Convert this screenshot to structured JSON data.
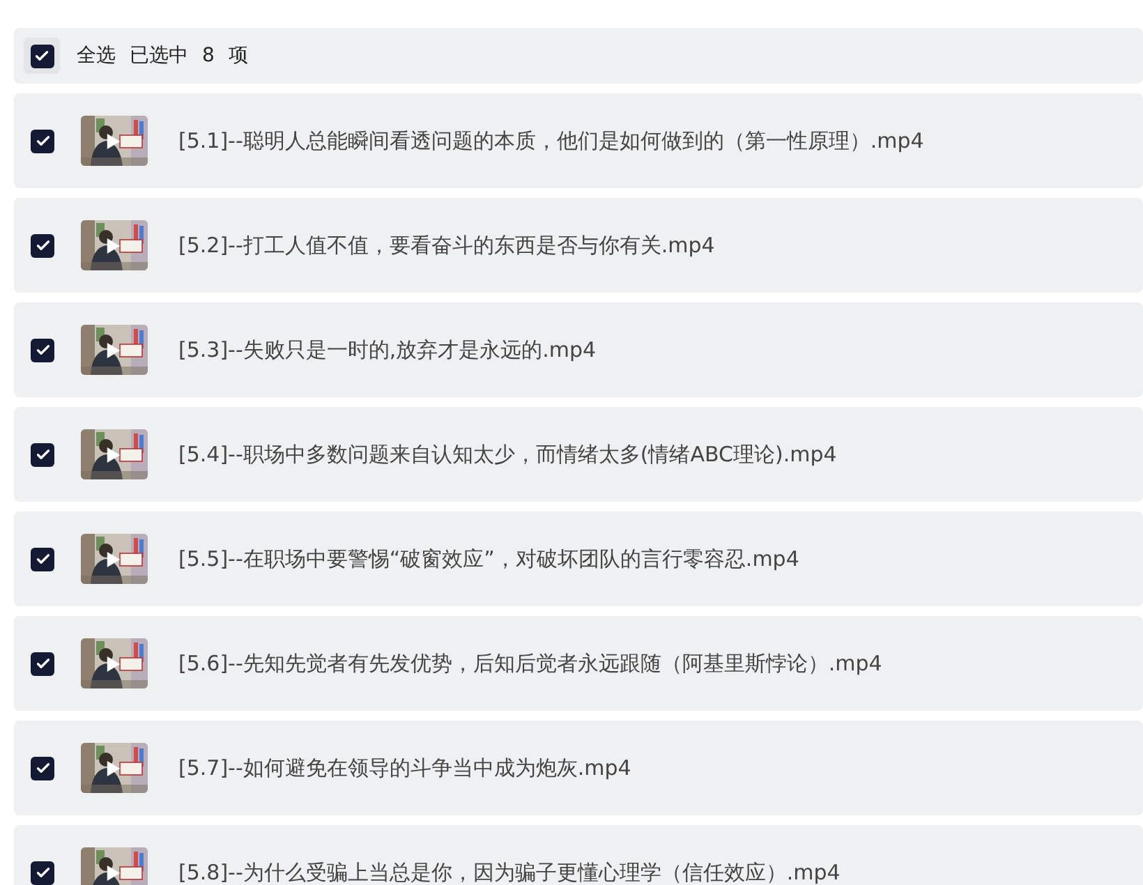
{
  "header": {
    "checked": true,
    "select_all_label": "全选",
    "selected_prefix": "已选中",
    "selected_count": "8",
    "selected_suffix": "项"
  },
  "files": [
    {
      "name": "[5.1]--聪明人总能瞬间看透问题的本质，他们是如何做到的（第一性原理）.mp4",
      "checked": true
    },
    {
      "name": "[5.2]--打工人值不值，要看奋斗的东西是否与你有关.mp4",
      "checked": true
    },
    {
      "name": "[5.3]--失败只是一时的,放弃才是永远的.mp4",
      "checked": true
    },
    {
      "name": "[5.4]--职场中多数问题来自认知太少，而情绪太多(情绪ABC理论).mp4",
      "checked": true
    },
    {
      "name": "[5.5]--在职场中要警惕“破窗效应”，对破坏团队的言行零容忍.mp4",
      "checked": true
    },
    {
      "name": "[5.6]--先知先觉者有先发优势，后知后觉者永远跟随（阿基里斯悖论）.mp4",
      "checked": true
    },
    {
      "name": "[5.7]--如何避免在领导的斗争当中成为炮灰.mp4",
      "checked": true
    },
    {
      "name": "[5.8]--为什么受骗上当总是你，因为骗子更懂心理学（信任效应）.mp4",
      "checked": true
    }
  ]
}
